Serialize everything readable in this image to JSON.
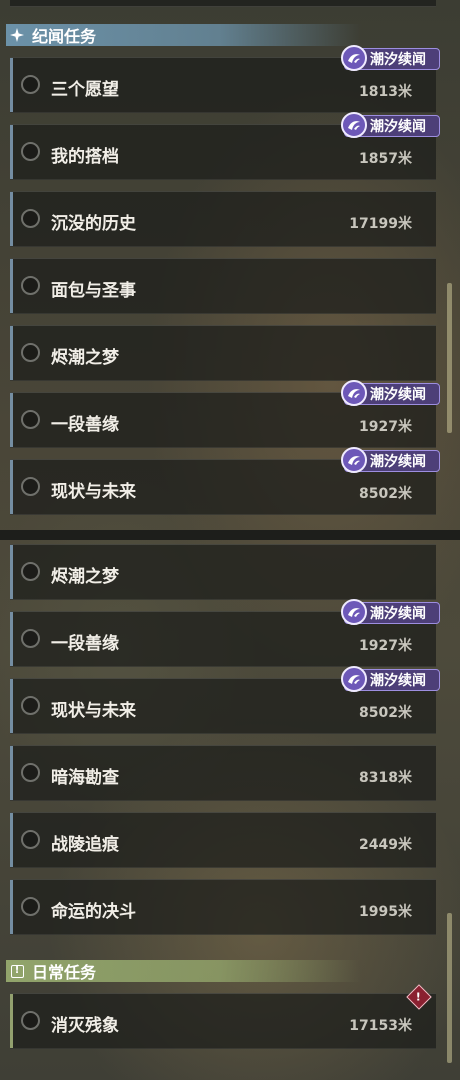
{
  "sections": {
    "lore": {
      "title": "纪闻任务"
    },
    "daily": {
      "title": "日常任务"
    }
  },
  "tag_label": "潮汐续闻",
  "panel1": {
    "quests": [
      {
        "name": "三个愿望",
        "distance": "1813米",
        "tag": true
      },
      {
        "name": "我的搭档",
        "distance": "1857米",
        "tag": true
      },
      {
        "name": "沉没的历史",
        "distance": "17199米",
        "tag": false
      },
      {
        "name": "面包与圣事",
        "distance": "",
        "tag": false
      },
      {
        "name": "烬潮之梦",
        "distance": "",
        "tag": false
      },
      {
        "name": "一段善缘",
        "distance": "1927米",
        "tag": true
      },
      {
        "name": "现状与未来",
        "distance": "8502米",
        "tag": true
      }
    ]
  },
  "panel2": {
    "quests": [
      {
        "name": "烬潮之梦",
        "distance": "",
        "tag": false
      },
      {
        "name": "一段善缘",
        "distance": "1927米",
        "tag": true
      },
      {
        "name": "现状与未来",
        "distance": "8502米",
        "tag": true
      },
      {
        "name": "暗海勘查",
        "distance": "8318米",
        "tag": false
      },
      {
        "name": "战陵追痕",
        "distance": "2449米",
        "tag": false
      },
      {
        "name": "命运的决斗",
        "distance": "1995米",
        "tag": false
      }
    ],
    "daily_quests": [
      {
        "name": "消灭残象",
        "distance": "17153米",
        "warning": true
      }
    ]
  },
  "colors": {
    "lore_header": "#6e96af",
    "daily_header": "#96aa6e",
    "tag_bg": "#4d3f78",
    "warning": "#8a2030"
  },
  "icons": {
    "lore_header": "sparkle-icon",
    "daily_header": "alert-box-icon",
    "tag": "tide-emblem-icon",
    "quest_status": "circle-radio-icon",
    "warning": "warning-diamond-icon"
  }
}
